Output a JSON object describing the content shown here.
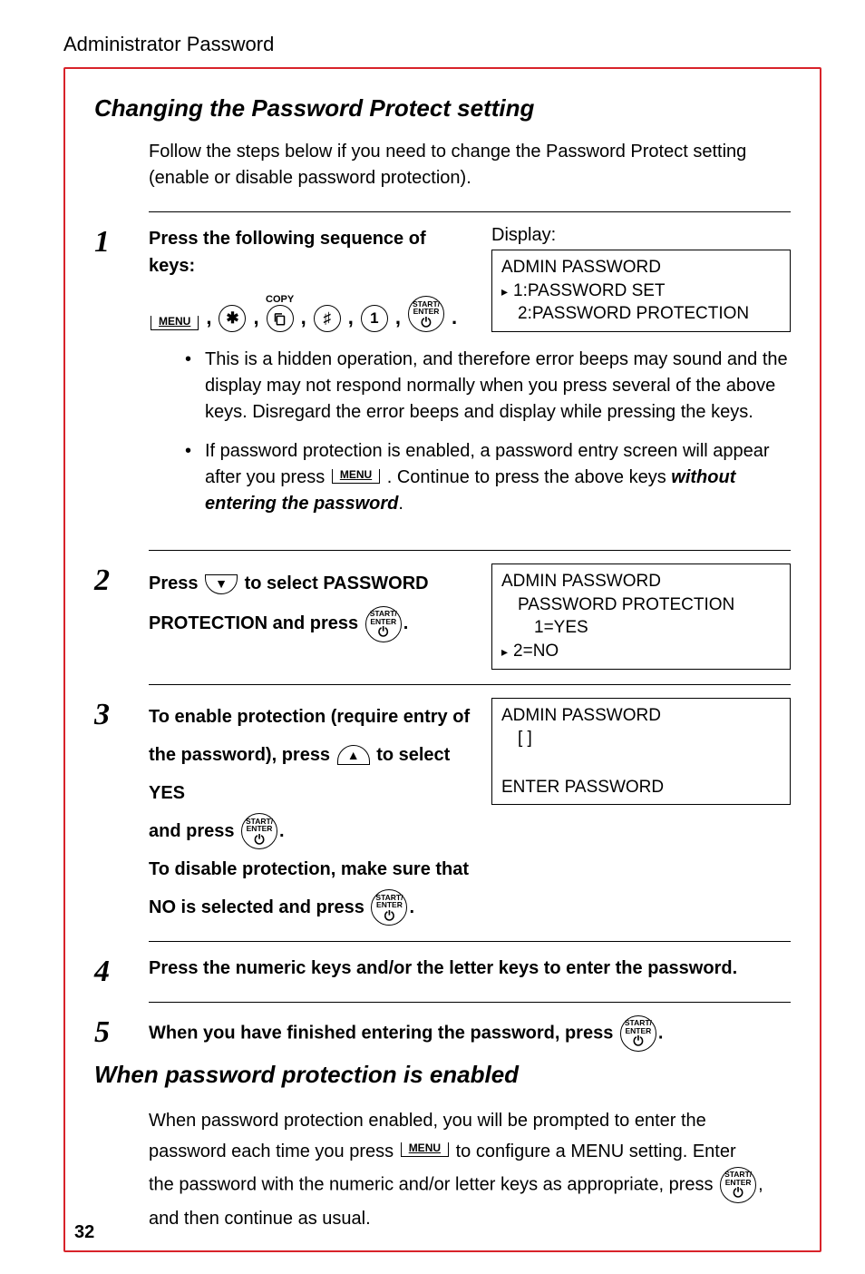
{
  "header": {
    "title": "Administrator Password"
  },
  "section1": {
    "title": "Changing the Password Protect setting",
    "intro": "Follow the steps below if you need to change the Password Protect setting (enable or disable password protection)."
  },
  "step1": {
    "num": "1",
    "instruction": "Press the following sequence of keys:",
    "display_label": "Display:",
    "display": {
      "line1": "ADMIN PASSWORD",
      "line2": "1:PASSWORD SET",
      "line3": "2:PASSWORD PROTECTION"
    },
    "keys": {
      "menu": "MENU",
      "star": "✱",
      "copy_label": "COPY",
      "copy_icon": "📋",
      "hash": "♯",
      "one": "1",
      "enter_top": "START/",
      "enter_bot": "ENTER",
      "period": "."
    },
    "bullets": {
      "b1": "This is a hidden operation, and therefore error beeps may sound and the display may not respond normally when you press several of the above keys. Disregard the error beeps and display while pressing the keys.",
      "b2a": "If password protection is enabled, a password entry screen will appear after you press ",
      "b2b": ". Continue to press the above keys ",
      "b2c": "without entering the password",
      "b2d": "."
    }
  },
  "step2": {
    "num": "2",
    "inst1": "Press ",
    "inst2": " to select PASSWORD",
    "inst3": "PROTECTION and press ",
    "period": ".",
    "display": {
      "line1": "ADMIN PASSWORD",
      "line2": "PASSWORD PROTECTION",
      "line3": "1=YES",
      "line4": "2=NO"
    }
  },
  "step3": {
    "num": "3",
    "inst1": "To enable protection (require entry of",
    "inst2": "the password), press ",
    "inst3": " to select YES",
    "inst4": "and press ",
    "period": ".",
    "inst5": "To disable protection, make sure that",
    "inst6": "NO is selected and press ",
    "display": {
      "line1": "ADMIN PASSWORD",
      "line2": "[                          ]",
      "line3": "ENTER PASSWORD"
    }
  },
  "step4": {
    "num": "4",
    "inst": "Press the numeric keys and/or the letter keys to enter the password."
  },
  "step5": {
    "num": "5",
    "inst": "When you have finished entering the password, press ",
    "period": "."
  },
  "section2": {
    "title": "When password protection is enabled",
    "p1a": "When password protection enabled, you will be prompted to enter the",
    "p1b": "password each time you press ",
    "p1c": " to configure a MENU setting. Enter",
    "p2a": "the password with the numeric and/or letter keys as appropriate, press ",
    "p2b": ",",
    "p3": "and then continue as usual."
  },
  "page_number": "32",
  "icons": {
    "down": "▼",
    "up": "▲",
    "power": "⏻"
  }
}
